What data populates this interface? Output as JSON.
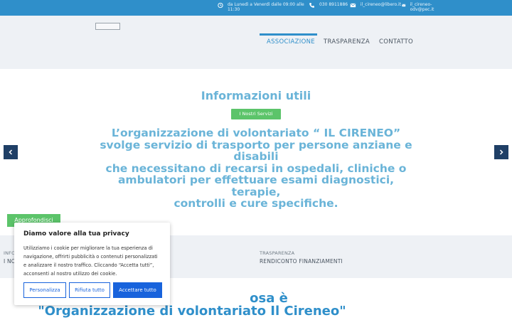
{
  "topbar": {
    "hours": "da Lunedì a Venerdì dalle 09:00 alle 11:30",
    "phone": "030 8911886",
    "email1": "il_cireneo@libero.it",
    "email2": "il_cireneo-odv@pec.it",
    "icons": [
      "clock-icon",
      "phone-icon",
      "mail-icon",
      "mail-icon"
    ]
  },
  "header": {
    "nav": {
      "associazione": "ASSOCIAZIONE",
      "trasparenza": "TRASPARENZA",
      "contatto": "CONTATTO"
    },
    "accent": "#2f8fca"
  },
  "hero": {
    "title": "Informazioni utili",
    "services_button": "I Nostri Servizi",
    "lines": [
      "L’organizzazione di volontariato “ IL CIRENEO”",
      "svolge servizio di trasporto per persone anziane e",
      "disabili",
      "che necessitano di recarsi in ospedali, cliniche o",
      "ambulatori per effettuare esami diagnostici,",
      "terapie,",
      "controlli e cure specifiche."
    ],
    "cta": "Approfondisci",
    "prev_icon": "chevron-left-icon",
    "next_icon": "chevron-right-icon"
  },
  "info": {
    "col1_cat": "INFO",
    "col1_link": "I NO",
    "col2_cat": "TRASPARENZA",
    "col2_link": "RENDICONTO FINANZIAMENTI"
  },
  "bottom": {
    "line1": "osa è",
    "line2": "\"Organizzazione di volontariato Il Cireneo\""
  },
  "cookie": {
    "title": "Diamo valore alla tua privacy",
    "text": "Utilizziamo i cookie per migliorare la tua esperienza di navigazione, offrirti pubblicità o contenuti personalizzati e analizzare il nostro traffico. Cliccando “Accetta tutti”, acconsenti al nostro utilizzo dei cookie.",
    "customize": "Personalizza",
    "reject": "Rifiuta tutto",
    "accept": "Accettare tutto"
  }
}
